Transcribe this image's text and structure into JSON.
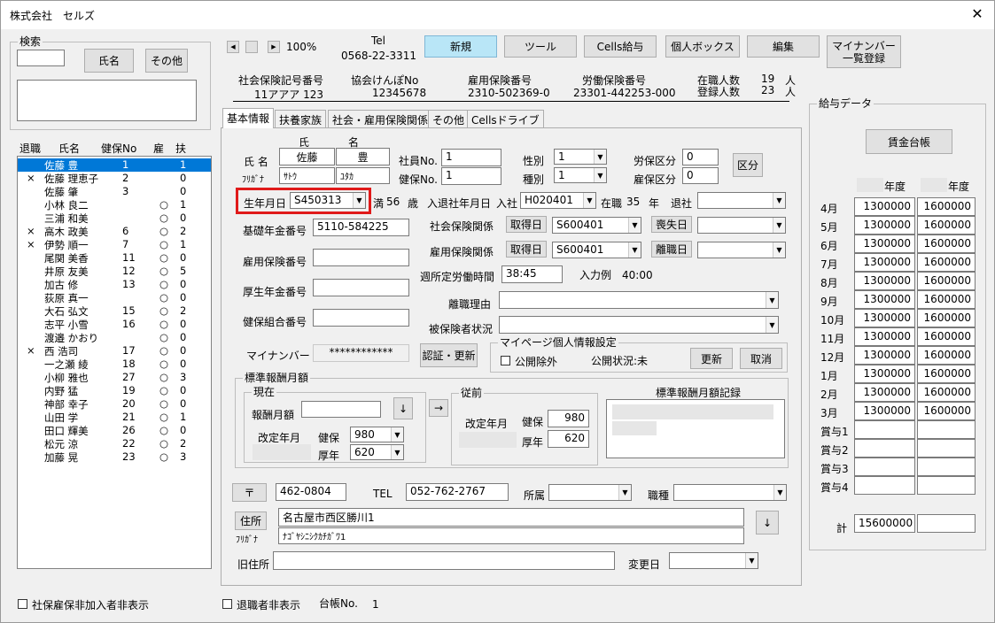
{
  "window": {
    "title": "株式会社　セルズ",
    "close": "✕"
  },
  "search": {
    "group_label": "検索",
    "input_value": "",
    "name_btn": "氏名",
    "other_btn": "その他",
    "result": ""
  },
  "list": {
    "headers": [
      "退職",
      "氏名",
      "健保No",
      "雇",
      "扶"
    ],
    "rows": [
      {
        "ret": "",
        "name": "佐藤 豊",
        "no": "1",
        "emp": "",
        "dep": "1",
        "selected": true
      },
      {
        "ret": "×",
        "name": "佐藤 理恵子",
        "no": "2",
        "emp": "",
        "dep": "0"
      },
      {
        "ret": "",
        "name": "佐藤 肇",
        "no": "3",
        "emp": "",
        "dep": "0"
      },
      {
        "ret": "",
        "name": "小林 良二",
        "no": "",
        "emp": "○",
        "dep": "1"
      },
      {
        "ret": "",
        "name": "三浦 和美",
        "no": "",
        "emp": "○",
        "dep": "0"
      },
      {
        "ret": "×",
        "name": "高木 政美",
        "no": "6",
        "emp": "○",
        "dep": "2"
      },
      {
        "ret": "×",
        "name": "伊勢 順一",
        "no": "7",
        "emp": "○",
        "dep": "1"
      },
      {
        "ret": "",
        "name": "尾関 美香",
        "no": "11",
        "emp": "○",
        "dep": "0"
      },
      {
        "ret": "",
        "name": "井原 友美",
        "no": "12",
        "emp": "○",
        "dep": "5"
      },
      {
        "ret": "",
        "name": "加古 修",
        "no": "13",
        "emp": "○",
        "dep": "0"
      },
      {
        "ret": "",
        "name": "荻原 真一",
        "no": "",
        "emp": "○",
        "dep": "0"
      },
      {
        "ret": "",
        "name": "大石 弘文",
        "no": "15",
        "emp": "○",
        "dep": "2"
      },
      {
        "ret": "",
        "name": "志平 小雪",
        "no": "16",
        "emp": "○",
        "dep": "0"
      },
      {
        "ret": "",
        "name": "渡邉 かおり",
        "no": "",
        "emp": "○",
        "dep": "0"
      },
      {
        "ret": "×",
        "name": "西 浩司",
        "no": "17",
        "emp": "○",
        "dep": "0"
      },
      {
        "ret": "",
        "name": "一之瀬 綾",
        "no": "18",
        "emp": "○",
        "dep": "0"
      },
      {
        "ret": "",
        "name": "小柳 雅也",
        "no": "27",
        "emp": "○",
        "dep": "3"
      },
      {
        "ret": "",
        "name": "内野 猛",
        "no": "19",
        "emp": "○",
        "dep": "0"
      },
      {
        "ret": "",
        "name": "神部 幸子",
        "no": "20",
        "emp": "○",
        "dep": "0"
      },
      {
        "ret": "",
        "name": "山田 学",
        "no": "21",
        "emp": "○",
        "dep": "1"
      },
      {
        "ret": "",
        "name": "田口 輝美",
        "no": "26",
        "emp": "○",
        "dep": "0"
      },
      {
        "ret": "",
        "name": "松元 涼",
        "no": "22",
        "emp": "○",
        "dep": "2"
      },
      {
        "ret": "",
        "name": "加藤 晃",
        "no": "23",
        "emp": "○",
        "dep": "3"
      }
    ]
  },
  "bottom_left": {
    "hide_unenrolled": "社保雇保非加入者非表示"
  },
  "toolbar": {
    "zoom": "100%",
    "tel_label": "Tel",
    "tel": "0568-22-3311",
    "buttons": [
      "新規",
      "ツール",
      "Cells給与",
      "個人ボックス",
      "編集"
    ],
    "mynumber_btn1": "マイナンバー",
    "mynumber_btn2": "一覧登録"
  },
  "company": {
    "h1": "社会保険記号番号",
    "v1": "11アアア 123",
    "h2": "協会けんぽNo",
    "v2": "12345678",
    "h3": "雇用保険番号",
    "v3": "2310-502369-0",
    "h4": "労働保険番号",
    "v4": "23301-442253-000",
    "active_label": "在職人数",
    "active": "19",
    "registered_label": "登録人数",
    "registered": "23",
    "unit": "人"
  },
  "tabs": [
    "基本情報",
    "扶養家族",
    "社会・雇用保険関係",
    "その他",
    "Cellsドライブ"
  ],
  "basic": {
    "name_label": "氏 名",
    "kana_label": "ﾌﾘｶﾞﾅ",
    "sei_head": "氏",
    "mei_head": "名",
    "sei": "佐藤",
    "mei": "豊",
    "sei_kana": "ｻﾄｳ",
    "mei_kana": "ﾕﾀｶ",
    "emp_no_label": "社員No.",
    "emp_no": "1",
    "kenpo_no_label": "健保No.",
    "kenpo_no": "1",
    "gender_label": "性別",
    "gender": "1",
    "type_label": "種別",
    "type": "1",
    "labor_label": "労保区分",
    "labor": "0",
    "emp_ins_label": "雇保区分",
    "emp_ins": "0",
    "kubun_btn": "区分",
    "birth_label": "生年月日",
    "birth": "S450313",
    "age_prefix": "満",
    "age": "56",
    "age_unit": "歳",
    "join_label": "入退社年月日",
    "join_prefix": "入社",
    "join": "H020401",
    "tenure_prefix": "在職",
    "tenure": "35",
    "tenure_unit": "年",
    "leave_label": "退社",
    "leave": "",
    "pension_label": "基礎年金番号",
    "pension": "5110-584225",
    "shaho_label": "社会保険関係",
    "shaho_get_btn": "取得日",
    "shaho_get": "S600401",
    "shaho_lost_btn": "喪失日",
    "shaho_lost": "",
    "koyo_rel_label": "雇用保険関係",
    "koyo_get_btn": "取得日",
    "koyo_get": "S600401",
    "koyo_leave_btn": "離職日",
    "koyo_leave": "",
    "koyo_no_label": "雇用保険番号",
    "koyo_no": "",
    "weekly_label": "週所定労働時間",
    "weekly": "38:45",
    "example": "入力例　40:00",
    "kosei_label": "厚生年金番号",
    "kosei": "",
    "reason_label": "離職理由",
    "reason": "",
    "union_label": "健保組合番号",
    "union": "",
    "insured_label": "被保険者状況",
    "insured": "",
    "mynumber_label": "マイナンバー",
    "mynumber": "************",
    "auth_btn": "認証・更新",
    "mypage_group": "マイページ個人情報設定",
    "public_exclude": "公開除外",
    "public_status": "公開状況:未",
    "update_btn": "更新",
    "cancel_btn": "取消"
  },
  "std": {
    "group": "標準報酬月額",
    "current": "現在",
    "monthly_label": "報酬月額",
    "monthly": "",
    "down_btn": "↓",
    "rev_label": "改定年月",
    "kenpo_label": "健保",
    "kenpo": "980",
    "kosei_label": "厚年",
    "kosei": "620",
    "arrow_btn": "→",
    "prev": "従前",
    "prev_rev_label": "改定年月",
    "prev_kenpo_label": "健保",
    "prev_kenpo": "980",
    "prev_kosei_label": "厚年",
    "prev_kosei": "620",
    "record_label": "標準報酬月額記録"
  },
  "address": {
    "zip_btn": "〒",
    "zip": "462-0804",
    "tel_label": "TEL",
    "tel": "052-762-2767",
    "dept_label": "所属",
    "dept": "",
    "job_label": "職種",
    "job": "",
    "addr_btn": "住所",
    "kana_label": "ﾌﾘｶﾞﾅ",
    "addr": "名古屋市西区勝川1",
    "addr_kana": "ﾅｺﾞﾔｼﾆｼｸｶﾁｶﾞﾜ1",
    "down_btn": "↓",
    "old_label": "旧住所",
    "old": "",
    "change_label": "変更日",
    "change": ""
  },
  "footer": {
    "hide_retired": "退職者非表示",
    "ledger_label": "台帳No.",
    "ledger": "1"
  },
  "salary": {
    "group": "給与データ",
    "ledger_btn": "賃金台帳",
    "year_suffix1": "年度",
    "year_suffix2": "年度",
    "rows": [
      {
        "m": "4月",
        "a": "1300000",
        "b": "1600000"
      },
      {
        "m": "5月",
        "a": "1300000",
        "b": "1600000"
      },
      {
        "m": "6月",
        "a": "1300000",
        "b": "1600000"
      },
      {
        "m": "7月",
        "a": "1300000",
        "b": "1600000"
      },
      {
        "m": "8月",
        "a": "1300000",
        "b": "1600000"
      },
      {
        "m": "9月",
        "a": "1300000",
        "b": "1600000"
      },
      {
        "m": "10月",
        "a": "1300000",
        "b": "1600000"
      },
      {
        "m": "11月",
        "a": "1300000",
        "b": "1600000"
      },
      {
        "m": "12月",
        "a": "1300000",
        "b": "1600000"
      },
      {
        "m": "1月",
        "a": "1300000",
        "b": "1600000"
      },
      {
        "m": "2月",
        "a": "1300000",
        "b": "1600000"
      },
      {
        "m": "3月",
        "a": "1300000",
        "b": "1600000"
      },
      {
        "m": "賞与1",
        "a": "",
        "b": ""
      },
      {
        "m": "賞与2",
        "a": "",
        "b": ""
      },
      {
        "m": "賞与3",
        "a": "",
        "b": ""
      },
      {
        "m": "賞与4",
        "a": "",
        "b": ""
      }
    ],
    "total_label": "計",
    "total_a": "15600000",
    "total_b": ""
  }
}
